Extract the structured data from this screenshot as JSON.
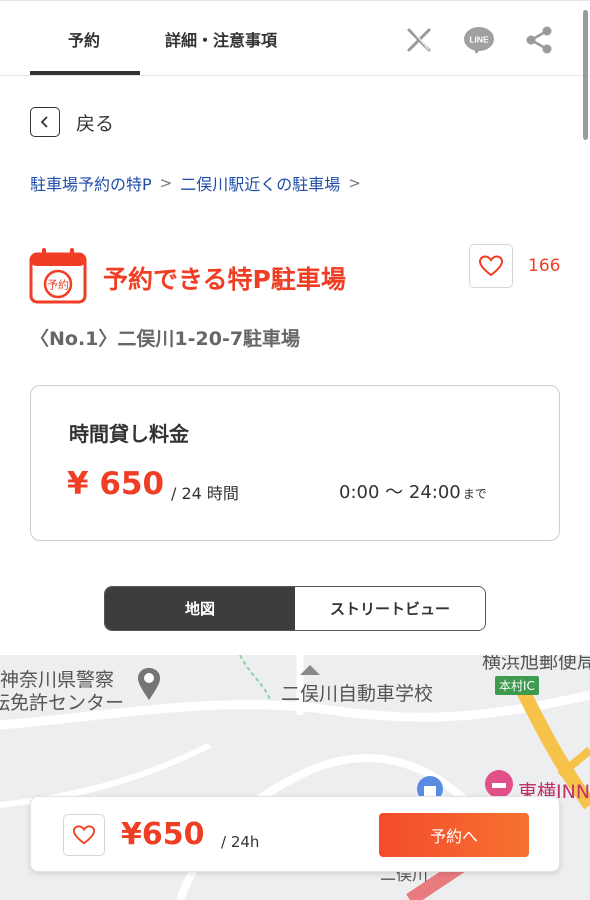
{
  "tabs": {
    "reserve": "予約",
    "details": "詳細・注意事項"
  },
  "share": {
    "x": "x-icon",
    "line": "LINE",
    "share": "share-icon"
  },
  "back": {
    "label": "戻る"
  },
  "breadcrumb": [
    {
      "label": "駐車場予約の特P"
    },
    {
      "label": "二俣川駅近くの駐車場"
    }
  ],
  "title": {
    "badge": "予約",
    "text": "予約できる特P駐車場",
    "favorite_count": "166",
    "subtitle": "〈No.1〉二俣川1-20-7駐車場"
  },
  "pricing": {
    "heading": "時間貸し料金",
    "amount": "¥ 650",
    "unit": "/ 24 時間",
    "hours_main": "0:00 〜 24:00",
    "hours_suffix": "まで"
  },
  "view_toggle": {
    "map": "地図",
    "street": "ストリートビュー",
    "selected": "地図"
  },
  "map": {
    "labels": {
      "police": "神奈川県警察",
      "license": "運転免許センター",
      "school": "二俣川自動車学校",
      "honmura_ic": "本村IC",
      "post": "横浜旭郵便局",
      "hotel": "東横INN",
      "futamatagawa": "二俣川"
    }
  },
  "bottom_bar": {
    "price": "¥650",
    "unit": "/ 24h",
    "reserve_button": "予約へ"
  },
  "colors": {
    "accent": "#ef3e24",
    "link": "#1f4da8",
    "toggle_active": "#3d3d3d"
  }
}
